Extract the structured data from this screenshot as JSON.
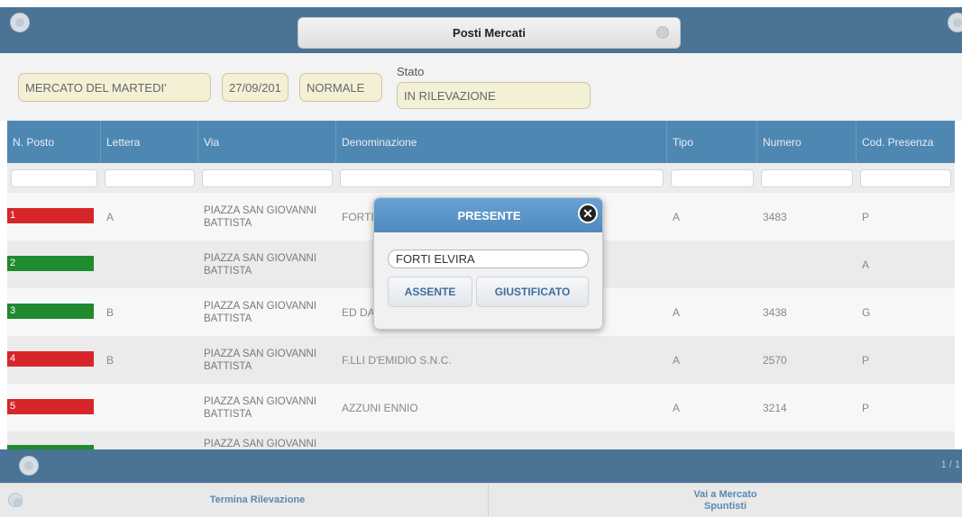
{
  "header": {
    "title": "Posti Mercati",
    "menu_icon": "menu-icon",
    "power_icon": "power-icon",
    "color": "#4a7396"
  },
  "filters": {
    "mercato": "MERCATO DEL MARTEDI'",
    "data": "27/09/201",
    "tipo": "NORMALE",
    "stato_label": "Stato",
    "stato": "IN RILEVAZIONE"
  },
  "table": {
    "columns": [
      "N. Posto",
      "Lettera",
      "Via",
      "Denominazione",
      "Tipo",
      "Numero",
      "Cod. Presenza"
    ],
    "rows": [
      {
        "posto": "1",
        "status": "red",
        "lettera": "A",
        "via": "PIAZZA SAN GIOVANNI BATTISTA",
        "denominazione": "FORTI",
        "tipo": "A",
        "numero": "3483",
        "cod": "P"
      },
      {
        "posto": "2",
        "status": "green",
        "lettera": "",
        "via": "PIAZZA SAN GIOVANNI BATTISTA",
        "denominazione": "",
        "tipo": "",
        "numero": "",
        "cod": "A"
      },
      {
        "posto": "3",
        "status": "green",
        "lettera": "B",
        "via": "PIAZZA SAN GIOVANNI BATTISTA",
        "denominazione": "ED DA",
        "tipo": "A",
        "numero": "3438",
        "cod": "G"
      },
      {
        "posto": "4",
        "status": "red",
        "lettera": "B",
        "via": "PIAZZA SAN GIOVANNI BATTISTA",
        "denominazione": "F.LLI D'EMIDIO S.N.C.",
        "tipo": "A",
        "numero": "2570",
        "cod": "P"
      },
      {
        "posto": "5",
        "status": "red",
        "lettera": "",
        "via": "PIAZZA SAN GIOVANNI BATTISTA",
        "denominazione": "AZZUNI ENNIO",
        "tipo": "A",
        "numero": "3214",
        "cod": "P"
      },
      {
        "posto": "",
        "status": "green",
        "lettera": "",
        "via": "PIAZZA SAN GIOVANNI",
        "denominazione": "",
        "tipo": "",
        "numero": "",
        "cod": ""
      }
    ],
    "status_colors": {
      "red": "#d6262a",
      "green": "#1f8a2e"
    }
  },
  "pager": {
    "page": "1 / 1",
    "icon": "refresh-icon"
  },
  "footer": {
    "left_icon": "circle-icon",
    "termina": "Termina Rilevazione",
    "vai_line1": "Vai a Mercato",
    "vai_line2": "Spuntisti"
  },
  "dialog": {
    "title": "PRESENTE",
    "name": "FORTI ELVIRA",
    "assente": "ASSENTE",
    "giustificato": "GIUSTIFICATO",
    "close_icon": "close-icon"
  }
}
